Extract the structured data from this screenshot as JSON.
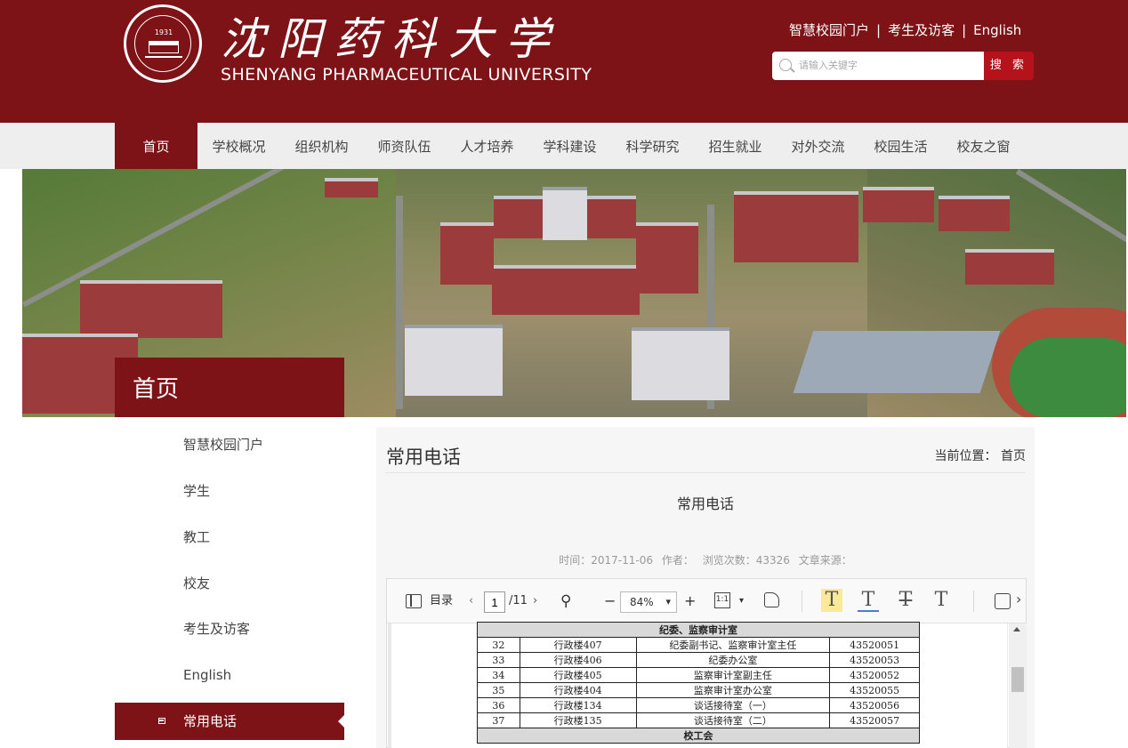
{
  "header": {
    "logo_year": "1931",
    "university_cn": "沈阳药科大学",
    "university_en": "SHENYANG PHARMACEUTICAL UNIVERSITY",
    "top_links": [
      "智慧校园门户",
      "考生及访客",
      "English"
    ],
    "separator": "|",
    "search_placeholder": "请输入关键字",
    "search_button": "搜 索",
    "brand_color": "#7d1316"
  },
  "nav": {
    "items": [
      "首页",
      "学校概况",
      "组织机构",
      "师资队伍",
      "人才培养",
      "学科建设",
      "科学研究",
      "招生就业",
      "对外交流",
      "校园生活",
      "校友之窗"
    ],
    "active": "首页"
  },
  "banner": {
    "title": "首页"
  },
  "sidebar": {
    "items": [
      "智慧校园门户",
      "学生",
      "教工",
      "校友",
      "考生及访客",
      "English",
      "常用电话"
    ],
    "active": "常用电话"
  },
  "content": {
    "title": "常用电话",
    "breadcrumb": "当前位置：  首页",
    "article_title": "常用电话",
    "meta": {
      "time": "时间：2017-11-06",
      "author": "作者：",
      "views": "浏览次数：43326",
      "source": "文章来源："
    }
  },
  "viewer": {
    "toc_label": "目录",
    "page_current": "1",
    "page_total": "/11",
    "zoom": "84%",
    "fit_label": "1:1",
    "text_tool_glyph": "T"
  },
  "phone_table": {
    "group_top": "纪委、监察审计室",
    "rows": [
      [
        "32",
        "行政楼407",
        "纪委副书记、监察审计室主任",
        "43520051"
      ],
      [
        "33",
        "行政楼406",
        "纪委办公室",
        "43520053"
      ],
      [
        "34",
        "行政楼405",
        "监察审计室副主任",
        "43520052"
      ],
      [
        "35",
        "行政楼404",
        "监察审计室办公室",
        "43520055"
      ],
      [
        "36",
        "行政楼134",
        "谈话接待室（一）",
        "43520056"
      ],
      [
        "37",
        "行政楼135",
        "谈话接待室（二）",
        "43520057"
      ]
    ],
    "group_bottom": "校工会"
  }
}
